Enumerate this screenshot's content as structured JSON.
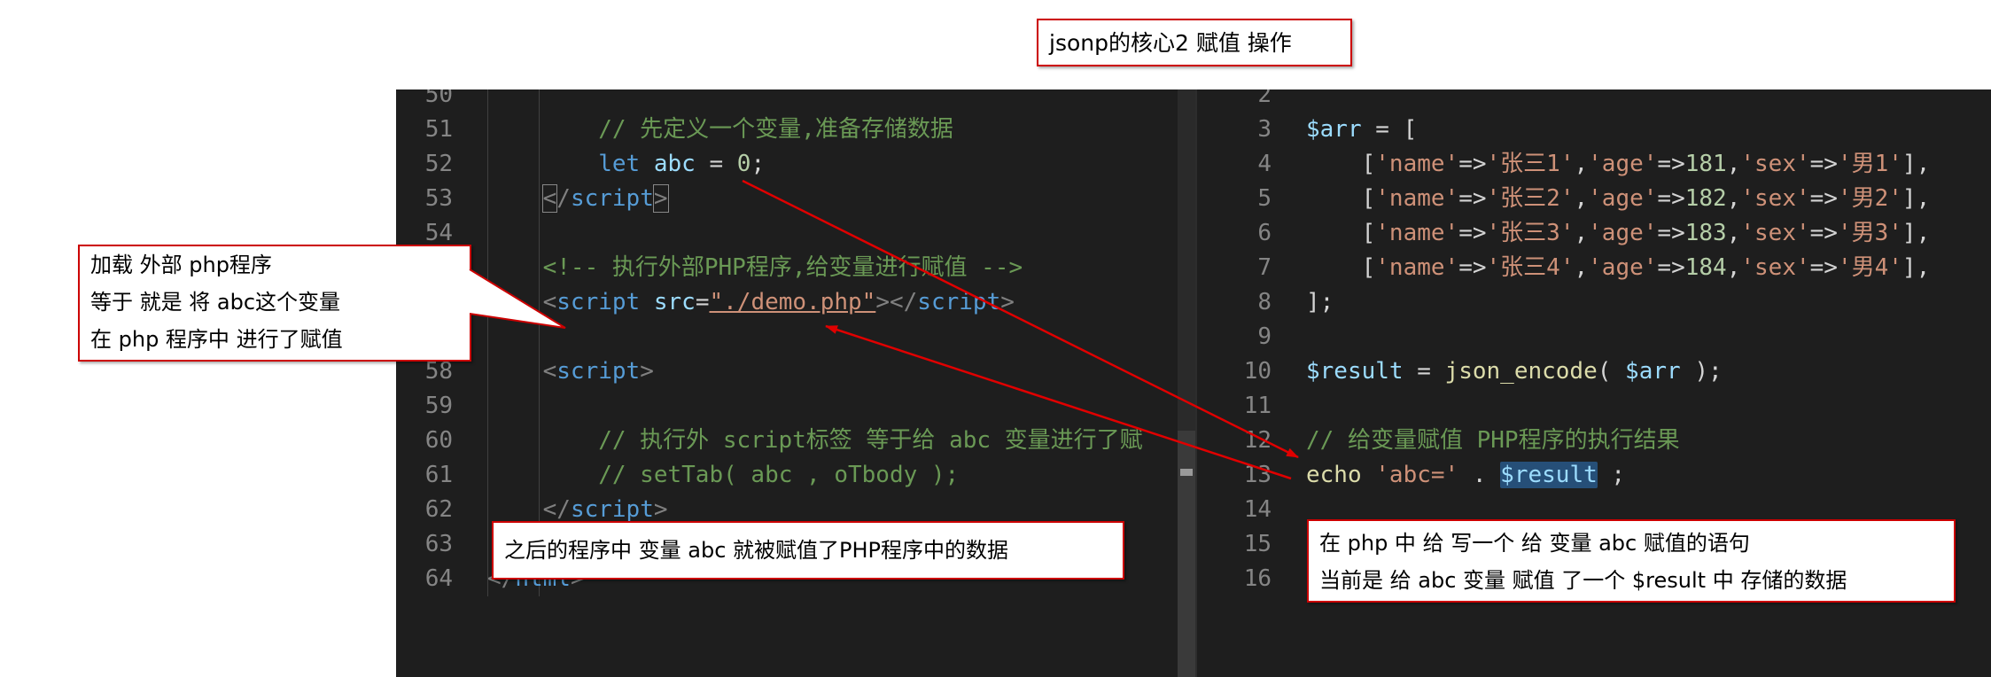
{
  "title_callout": {
    "text": "jsonp的核心2 赋值 操作"
  },
  "left_callout": {
    "lines": [
      "加载 外部 php程序",
      "等于 就是 将 abc这个变量",
      "在 php 程序中 进行了赋值"
    ]
  },
  "bottom_callout": {
    "text": "之后的程序中 变量 abc 就被赋值了PHP程序中的数据"
  },
  "right_callout": {
    "lines": [
      "在 php 中 给 写一个 给  变量 abc 赋值的语句",
      "当前是 给 abc 变量 赋值 了一个 $result 中 存储的数据"
    ]
  },
  "left_editor": {
    "lines": [
      {
        "num": "50",
        "tokens": []
      },
      {
        "num": "51",
        "tokens": [
          {
            "t": "        // 先定义一个变量,准备存储数据",
            "c": "c-comment"
          }
        ]
      },
      {
        "num": "52",
        "tokens": [
          {
            "t": "        ",
            "c": "c-plain"
          },
          {
            "t": "let",
            "c": "c-kw"
          },
          {
            "t": " ",
            "c": "c-plain"
          },
          {
            "t": "abc",
            "c": "c-var"
          },
          {
            "t": " = ",
            "c": "c-plain"
          },
          {
            "t": "0",
            "c": "c-num"
          },
          {
            "t": ";",
            "c": "c-plain"
          }
        ]
      },
      {
        "num": "53",
        "tokens": [
          {
            "t": "    ",
            "c": "c-plain"
          },
          {
            "t": "<",
            "c": "c-bracket hl-box"
          },
          {
            "t": "/",
            "c": "c-bracket"
          },
          {
            "t": "script",
            "c": "c-tag"
          },
          {
            "t": ">",
            "c": "c-bracket hl-box"
          }
        ]
      },
      {
        "num": "54",
        "tokens": []
      },
      {
        "num": "55",
        "tokens": [
          {
            "t": "    <!-- 执行外部PHP程序,给变量进行赋值 -->",
            "c": "c-comment"
          }
        ]
      },
      {
        "num": "56",
        "tokens": [
          {
            "t": "    ",
            "c": "c-plain"
          },
          {
            "t": "<",
            "c": "c-bracket"
          },
          {
            "t": "script",
            "c": "c-tag"
          },
          {
            "t": " ",
            "c": "c-plain"
          },
          {
            "t": "src",
            "c": "c-attr"
          },
          {
            "t": "=",
            "c": "c-plain"
          },
          {
            "t": "\"./demo.php\"",
            "c": "c-str underline"
          },
          {
            "t": "></",
            "c": "c-bracket"
          },
          {
            "t": "script",
            "c": "c-tag"
          },
          {
            "t": ">",
            "c": "c-bracket"
          }
        ]
      },
      {
        "num": "57",
        "tokens": []
      },
      {
        "num": "58",
        "tokens": [
          {
            "t": "    ",
            "c": "c-plain"
          },
          {
            "t": "<",
            "c": "c-bracket"
          },
          {
            "t": "script",
            "c": "c-tag"
          },
          {
            "t": ">",
            "c": "c-bracket"
          }
        ]
      },
      {
        "num": "59",
        "tokens": []
      },
      {
        "num": "60",
        "tokens": [
          {
            "t": "        // 执行外 script标签 等于给 abc 变量进行了赋",
            "c": "c-comment"
          }
        ]
      },
      {
        "num": "61",
        "tokens": [
          {
            "t": "        // setTab( abc , oTbody );",
            "c": "c-comment"
          }
        ]
      },
      {
        "num": "62",
        "tokens": [
          {
            "t": "    ",
            "c": "c-plain"
          },
          {
            "t": "</",
            "c": "c-bracket"
          },
          {
            "t": "script",
            "c": "c-tag"
          },
          {
            "t": ">",
            "c": "c-bracket"
          }
        ]
      },
      {
        "num": "63",
        "tokens": []
      },
      {
        "num": "64",
        "tokens": [
          {
            "t": "</",
            "c": "c-bracket"
          },
          {
            "t": "html",
            "c": "c-tag"
          },
          {
            "t": ">",
            "c": "c-bracket"
          }
        ]
      }
    ]
  },
  "right_editor": {
    "lines": [
      {
        "num": "2",
        "tokens": []
      },
      {
        "num": "3",
        "tokens": [
          {
            "t": "$arr",
            "c": "c-var"
          },
          {
            "t": " = [",
            "c": "c-plain"
          }
        ]
      },
      {
        "num": "4",
        "tokens": [
          {
            "t": "    [",
            "c": "c-plain"
          },
          {
            "t": "'name'",
            "c": "c-str"
          },
          {
            "t": "=>",
            "c": "c-plain"
          },
          {
            "t": "'张三1'",
            "c": "c-str"
          },
          {
            "t": ",",
            "c": "c-plain"
          },
          {
            "t": "'age'",
            "c": "c-str"
          },
          {
            "t": "=>",
            "c": "c-plain"
          },
          {
            "t": "181",
            "c": "c-num"
          },
          {
            "t": ",",
            "c": "c-plain"
          },
          {
            "t": "'sex'",
            "c": "c-str"
          },
          {
            "t": "=>",
            "c": "c-plain"
          },
          {
            "t": "'男1'",
            "c": "c-str"
          },
          {
            "t": "],",
            "c": "c-plain"
          }
        ]
      },
      {
        "num": "5",
        "tokens": [
          {
            "t": "    [",
            "c": "c-plain"
          },
          {
            "t": "'name'",
            "c": "c-str"
          },
          {
            "t": "=>",
            "c": "c-plain"
          },
          {
            "t": "'张三2'",
            "c": "c-str"
          },
          {
            "t": ",",
            "c": "c-plain"
          },
          {
            "t": "'age'",
            "c": "c-str"
          },
          {
            "t": "=>",
            "c": "c-plain"
          },
          {
            "t": "182",
            "c": "c-num"
          },
          {
            "t": ",",
            "c": "c-plain"
          },
          {
            "t": "'sex'",
            "c": "c-str"
          },
          {
            "t": "=>",
            "c": "c-plain"
          },
          {
            "t": "'男2'",
            "c": "c-str"
          },
          {
            "t": "],",
            "c": "c-plain"
          }
        ]
      },
      {
        "num": "6",
        "tokens": [
          {
            "t": "    [",
            "c": "c-plain"
          },
          {
            "t": "'name'",
            "c": "c-str"
          },
          {
            "t": "=>",
            "c": "c-plain"
          },
          {
            "t": "'张三3'",
            "c": "c-str"
          },
          {
            "t": ",",
            "c": "c-plain"
          },
          {
            "t": "'age'",
            "c": "c-str"
          },
          {
            "t": "=>",
            "c": "c-plain"
          },
          {
            "t": "183",
            "c": "c-num"
          },
          {
            "t": ",",
            "c": "c-plain"
          },
          {
            "t": "'sex'",
            "c": "c-str"
          },
          {
            "t": "=>",
            "c": "c-plain"
          },
          {
            "t": "'男3'",
            "c": "c-str"
          },
          {
            "t": "],",
            "c": "c-plain"
          }
        ]
      },
      {
        "num": "7",
        "tokens": [
          {
            "t": "    [",
            "c": "c-plain"
          },
          {
            "t": "'name'",
            "c": "c-str"
          },
          {
            "t": "=>",
            "c": "c-plain"
          },
          {
            "t": "'张三4'",
            "c": "c-str"
          },
          {
            "t": ",",
            "c": "c-plain"
          },
          {
            "t": "'age'",
            "c": "c-str"
          },
          {
            "t": "=>",
            "c": "c-plain"
          },
          {
            "t": "184",
            "c": "c-num"
          },
          {
            "t": ",",
            "c": "c-plain"
          },
          {
            "t": "'sex'",
            "c": "c-str"
          },
          {
            "t": "=>",
            "c": "c-plain"
          },
          {
            "t": "'男4'",
            "c": "c-str"
          },
          {
            "t": "],",
            "c": "c-plain"
          }
        ]
      },
      {
        "num": "8",
        "tokens": [
          {
            "t": "];",
            "c": "c-plain"
          }
        ]
      },
      {
        "num": "9",
        "tokens": []
      },
      {
        "num": "10",
        "tokens": [
          {
            "t": "$result",
            "c": "c-var"
          },
          {
            "t": " = ",
            "c": "c-plain"
          },
          {
            "t": "json_encode",
            "c": "c-fn"
          },
          {
            "t": "( ",
            "c": "c-plain"
          },
          {
            "t": "$arr",
            "c": "c-var"
          },
          {
            "t": " );",
            "c": "c-plain"
          }
        ]
      },
      {
        "num": "11",
        "tokens": []
      },
      {
        "num": "12",
        "tokens": [
          {
            "t": "// 给变量赋值 PHP程序的执行结果",
            "c": "c-comment"
          }
        ]
      },
      {
        "num": "13",
        "tokens": [
          {
            "t": "echo",
            "c": "c-fn"
          },
          {
            "t": " ",
            "c": "c-plain"
          },
          {
            "t": "'abc='",
            "c": "c-str"
          },
          {
            "t": " . ",
            "c": "c-plain"
          },
          {
            "t": "$result",
            "c": "c-var sel-bg"
          },
          {
            "t": " ;",
            "c": "c-plain"
          }
        ]
      },
      {
        "num": "14",
        "tokens": []
      },
      {
        "num": "15",
        "tokens": []
      },
      {
        "num": "16",
        "tokens": []
      }
    ]
  },
  "colors": {
    "editor_bg": "#1e1e1e",
    "callout_border": "#cc0000",
    "arrow": "#e00000"
  }
}
